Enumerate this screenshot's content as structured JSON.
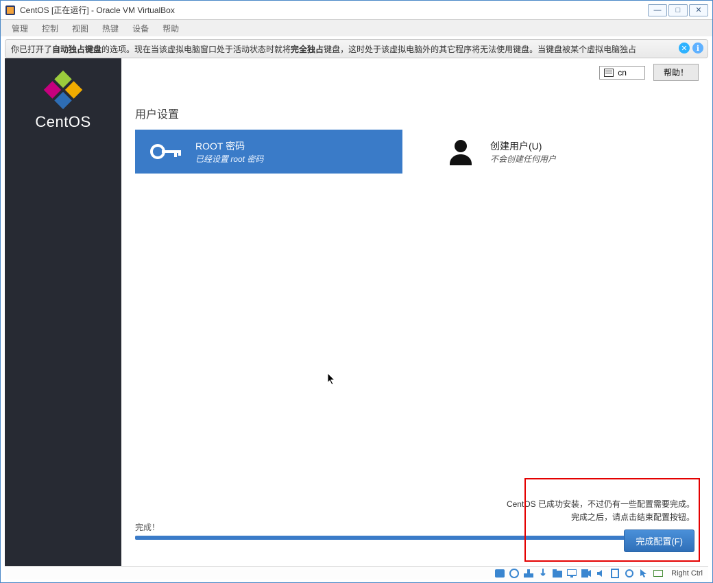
{
  "window": {
    "title": "CentOS [正在运行] - Oracle VM VirtualBox"
  },
  "menu": {
    "items": [
      "管理",
      "控制",
      "视图",
      "热键",
      "设备",
      "帮助"
    ]
  },
  "notification": {
    "prefix": "你已打开了 ",
    "bold1": "自动独占键盘",
    "mid": " 的选项。现在当该虚拟电脑窗口处于活动状态时就将 ",
    "bold2": "完全独占",
    "suffix": " 键盘，这时处于该虚拟电脑外的其它程序将无法使用键盘。当键盘被某个虚拟电脑独占"
  },
  "sidebar": {
    "brand": "CentOS"
  },
  "topbar": {
    "keyboard_indicator": "cn",
    "help_label": "帮助！"
  },
  "section": {
    "title": "用户设置"
  },
  "cards": {
    "root": {
      "title": "ROOT 密码",
      "subtitle": "已经设置 root 密码"
    },
    "user": {
      "title": "创建用户(U)",
      "subtitle": "不会创建任何用户"
    }
  },
  "progress": {
    "label": "完成！"
  },
  "finish": {
    "line1": "CentOS 已成功安装，不过仍有一些配置需要完成。",
    "line2": "完成之后，请点击结束配置按钮。",
    "button": "完成配置(F)"
  },
  "statusbar": {
    "host_key": "Right Ctrl"
  }
}
